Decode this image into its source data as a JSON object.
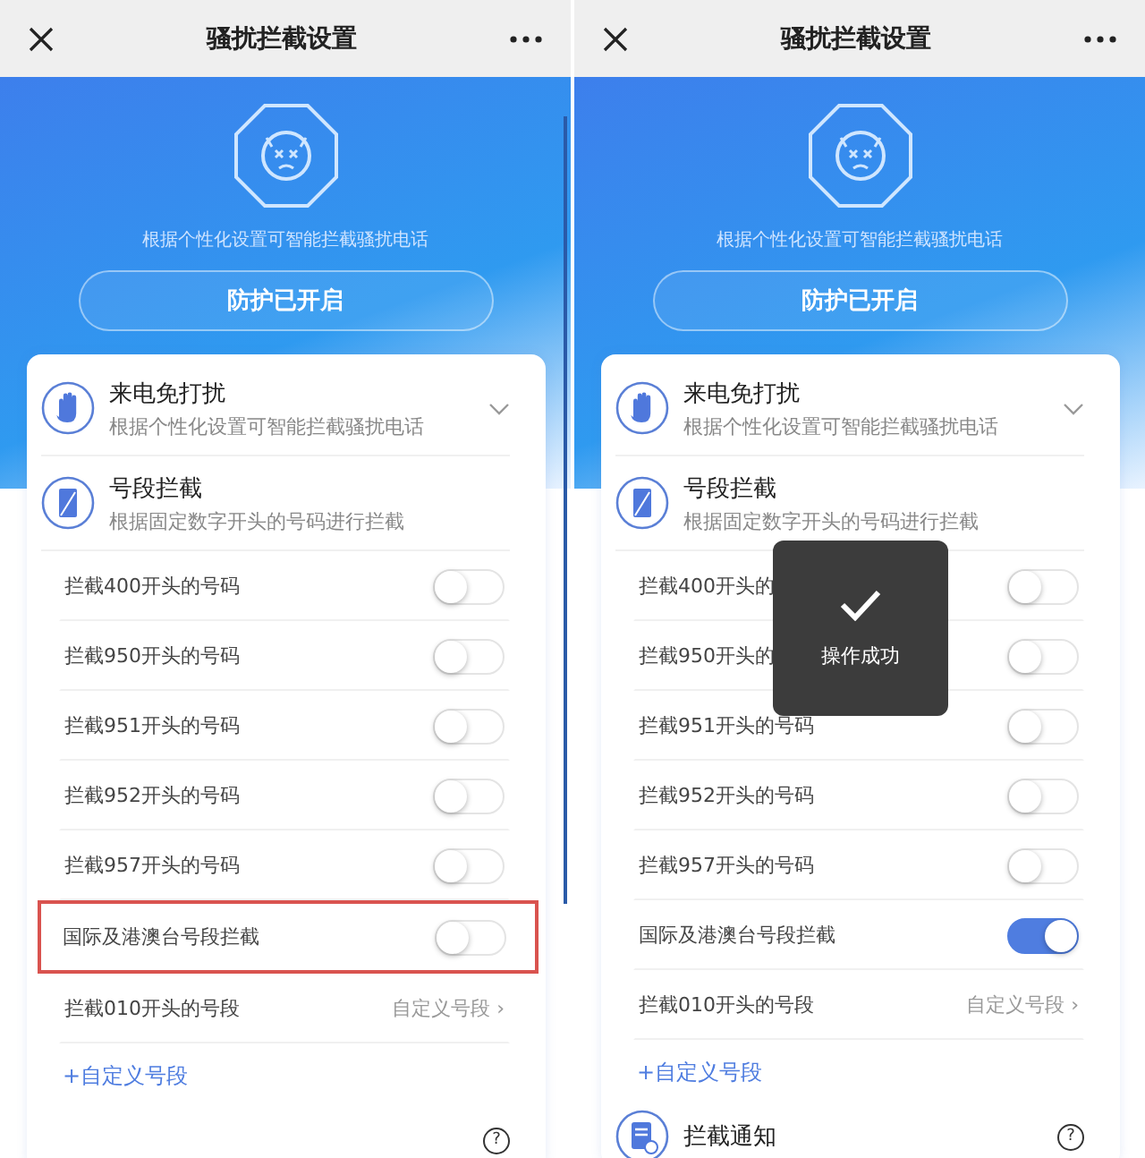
{
  "screens": [
    {
      "title": "骚扰拦截设置",
      "scrollbar": true,
      "hero_text": "根据个性化设置可智能拦截骚扰电话",
      "status_button": "防护已开启",
      "sections": [
        {
          "kind": "hand",
          "title": "来电免打扰",
          "subtitle": "根据个性化设置可智能拦截骚扰电话",
          "expandable": true
        },
        {
          "kind": "phone",
          "title": "号段拦截",
          "subtitle": "根据固定数字开头的号码进行拦截",
          "expandable": false
        }
      ],
      "rows": [
        {
          "kind": "switch",
          "label": "拦截400开头的号码",
          "on": false,
          "highlighted": false
        },
        {
          "kind": "switch",
          "label": "拦截950开头的号码",
          "on": false,
          "highlighted": false
        },
        {
          "kind": "switch",
          "label": "拦截951开头的号码",
          "on": false,
          "highlighted": false
        },
        {
          "kind": "switch",
          "label": "拦截952开头的号码",
          "on": false,
          "highlighted": false
        },
        {
          "kind": "switch",
          "label": "拦截957开头的号码",
          "on": false,
          "highlighted": false
        },
        {
          "kind": "switch",
          "label": "国际及港澳台号段拦截",
          "on": false,
          "highlighted": true
        },
        {
          "kind": "link",
          "label": "拦截010开头的号段",
          "value": "自定义号段 ›",
          "highlighted": false
        }
      ],
      "add_link": "+自定义号段",
      "notify": {
        "help": "?"
      }
    },
    {
      "title": "骚扰拦截设置",
      "scrollbar": false,
      "hero_text": "根据个性化设置可智能拦截骚扰电话",
      "status_button": "防护已开启",
      "sections": [
        {
          "kind": "hand",
          "title": "来电免打扰",
          "subtitle": "根据个性化设置可智能拦截骚扰电话",
          "expandable": true
        },
        {
          "kind": "phone",
          "title": "号段拦截",
          "subtitle": "根据固定数字开头的号码进行拦截",
          "expandable": false
        }
      ],
      "rows": [
        {
          "kind": "switch",
          "label": "拦截400开头的",
          "on": false,
          "highlighted": false
        },
        {
          "kind": "switch",
          "label": "拦截950开头的",
          "on": false,
          "highlighted": false
        },
        {
          "kind": "switch",
          "label": "拦截951开头的号码",
          "on": false,
          "highlighted": false
        },
        {
          "kind": "switch",
          "label": "拦截952开头的号码",
          "on": false,
          "highlighted": false
        },
        {
          "kind": "switch",
          "label": "拦截957开头的号码",
          "on": false,
          "highlighted": false
        },
        {
          "kind": "switch",
          "label": "国际及港澳台号段拦截",
          "on": true,
          "highlighted": false
        },
        {
          "kind": "link",
          "label": "拦截010开头的号段",
          "value": "自定义号段 ›",
          "highlighted": false
        }
      ],
      "add_link": "+自定义号段",
      "notify": {
        "title": "拦截通知",
        "help": "?"
      },
      "toast": "操作成功"
    }
  ]
}
